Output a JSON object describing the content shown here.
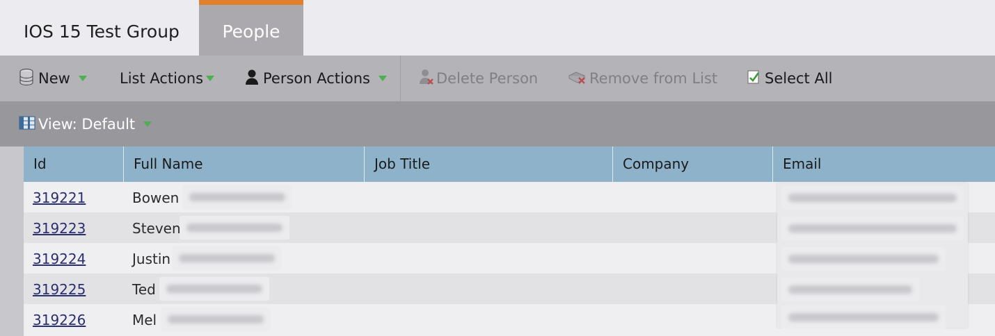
{
  "tabs": [
    {
      "label": "IOS 15 Test Group"
    },
    {
      "label": "People"
    }
  ],
  "toolbar": {
    "new": "New",
    "list_actions": "List Actions",
    "person_actions": "Person Actions",
    "delete_person": "Delete Person",
    "remove_from_list": "Remove from List",
    "select_all": "Select All"
  },
  "view": {
    "label": "View: Default"
  },
  "table": {
    "columns": [
      "Id",
      "Full Name",
      "Job Title",
      "Company",
      "Email"
    ],
    "rows": [
      {
        "id": "319221",
        "first_name": "Bowen"
      },
      {
        "id": "319223",
        "first_name": "Steven"
      },
      {
        "id": "319224",
        "first_name": "Justin"
      },
      {
        "id": "319225",
        "first_name": "Ted"
      },
      {
        "id": "319226",
        "first_name": "Mel"
      }
    ]
  },
  "colors": {
    "active_tab_accent": "#e07f2c",
    "header_bg": "#8fb2cb",
    "link": "#2b2e6f"
  }
}
